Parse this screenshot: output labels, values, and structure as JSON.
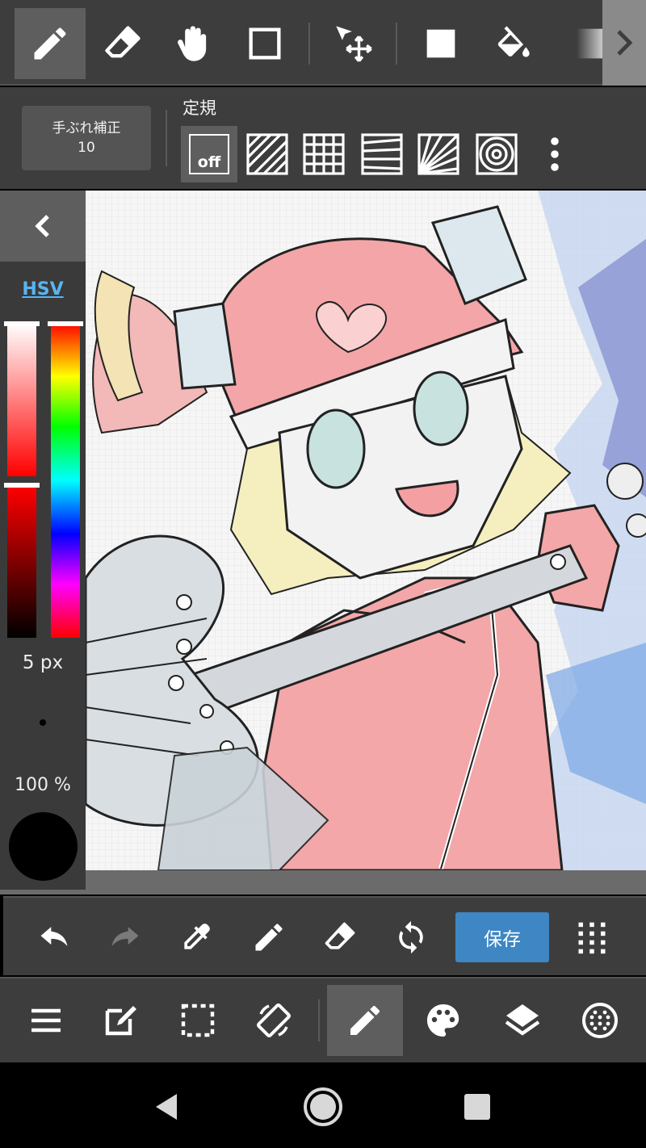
{
  "toolbar": {
    "tools": [
      {
        "name": "pen",
        "active": true
      },
      {
        "name": "eraser"
      },
      {
        "name": "hand"
      },
      {
        "name": "rectangle"
      },
      {
        "name": "move-select"
      },
      {
        "name": "fill-square"
      },
      {
        "name": "bucket"
      },
      {
        "name": "gradient"
      }
    ]
  },
  "stabilizer": {
    "label": "手ぶれ補正",
    "value": "10"
  },
  "ruler": {
    "title": "定規",
    "off_label": "off",
    "options": [
      "parallel",
      "grid",
      "perspective",
      "radial",
      "concentric"
    ]
  },
  "color_panel": {
    "mode_label": "HSV",
    "brush_size": "5 px",
    "opacity": "100 %",
    "current_color": "#000000"
  },
  "actions": {
    "save_label": "保存"
  },
  "colors": {
    "accent": "#3e86c4",
    "hsv_link": "#5ab4f0",
    "panel": "#3d3d3d",
    "active": "#5e5e5e"
  }
}
